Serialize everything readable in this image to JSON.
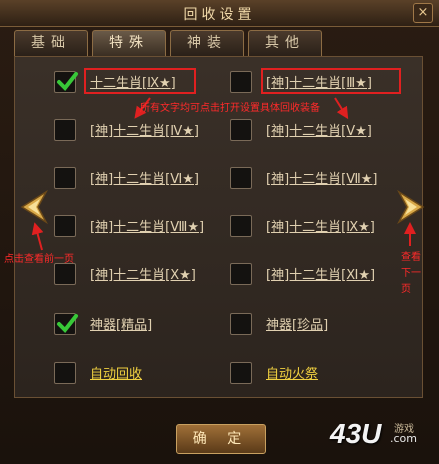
{
  "window": {
    "title": "回收设置",
    "close_label": "×"
  },
  "tabs": [
    {
      "label": "基础"
    },
    {
      "label": "特殊",
      "active": true
    },
    {
      "label": "神装"
    },
    {
      "label": "其他"
    }
  ],
  "items": [
    {
      "label": "十二生肖[Ⅸ★]",
      "checked": true
    },
    {
      "label": "[神]十二生肖[Ⅲ★]",
      "checked": false
    },
    {
      "label": "[神]十二生肖[Ⅳ★]",
      "checked": false
    },
    {
      "label": "[神]十二生肖[Ⅴ★]",
      "checked": false
    },
    {
      "label": "[神]十二生肖[Ⅵ★]",
      "checked": false
    },
    {
      "label": "[神]十二生肖[Ⅶ★]",
      "checked": false
    },
    {
      "label": "[神]十二生肖[Ⅷ★]",
      "checked": false
    },
    {
      "label": "[神]十二生肖[Ⅸ★]",
      "checked": false
    },
    {
      "label": "[神]十二生肖[Ⅹ★]",
      "checked": false
    },
    {
      "label": "[神]十二生肖[Ⅺ★]",
      "checked": false
    },
    {
      "label": "神器[精品]",
      "checked": true
    },
    {
      "label": "神器[珍品]",
      "checked": false
    },
    {
      "label": "自动回收",
      "checked": false
    },
    {
      "label": "自动火祭",
      "checked": false
    }
  ],
  "annotations": {
    "center": "所有文字均可点击打开设置具体回收装备",
    "left": "点击查看前一页",
    "right": "查看\n下一\n页"
  },
  "buttons": {
    "confirm": "确 定"
  },
  "logo": {
    "text": "43U",
    "suffix": ".com",
    "cn": "游戏"
  },
  "colors": {
    "annotation": "#e02020",
    "check": "#38c838",
    "label_yellow": "#f0d040"
  }
}
